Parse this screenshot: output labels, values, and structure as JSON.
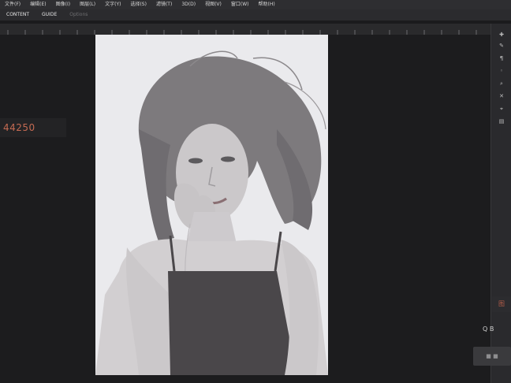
{
  "menubar": {
    "items": [
      "文件(F)",
      "编辑(E)",
      "图像(I)",
      "图层(L)",
      "文字(Y)",
      "选择(S)",
      "滤镜(T)",
      "3D(D)",
      "视图(V)",
      "窗口(W)",
      "帮助(H)"
    ]
  },
  "optionsbar": {
    "tabs": [
      "CONTENT",
      "GUIDE",
      "Options"
    ]
  },
  "workspace": {
    "info_value": "44250"
  },
  "right_panel": {
    "tab_a_label": "图",
    "tab_b_label": "Q B",
    "tab_c_label": "■ ■"
  },
  "colors": {
    "accent_text": "#c46a52",
    "canvas_bg": "#e9e9ec",
    "workspace_bg": "#1c1c1e",
    "panel_bg": "#2a2a2d"
  },
  "icons": [
    "move-icon",
    "brush-icon",
    "pin-icon",
    "lasso-icon",
    "search-icon",
    "tool-icon",
    "crop-icon",
    "layers-icon"
  ]
}
